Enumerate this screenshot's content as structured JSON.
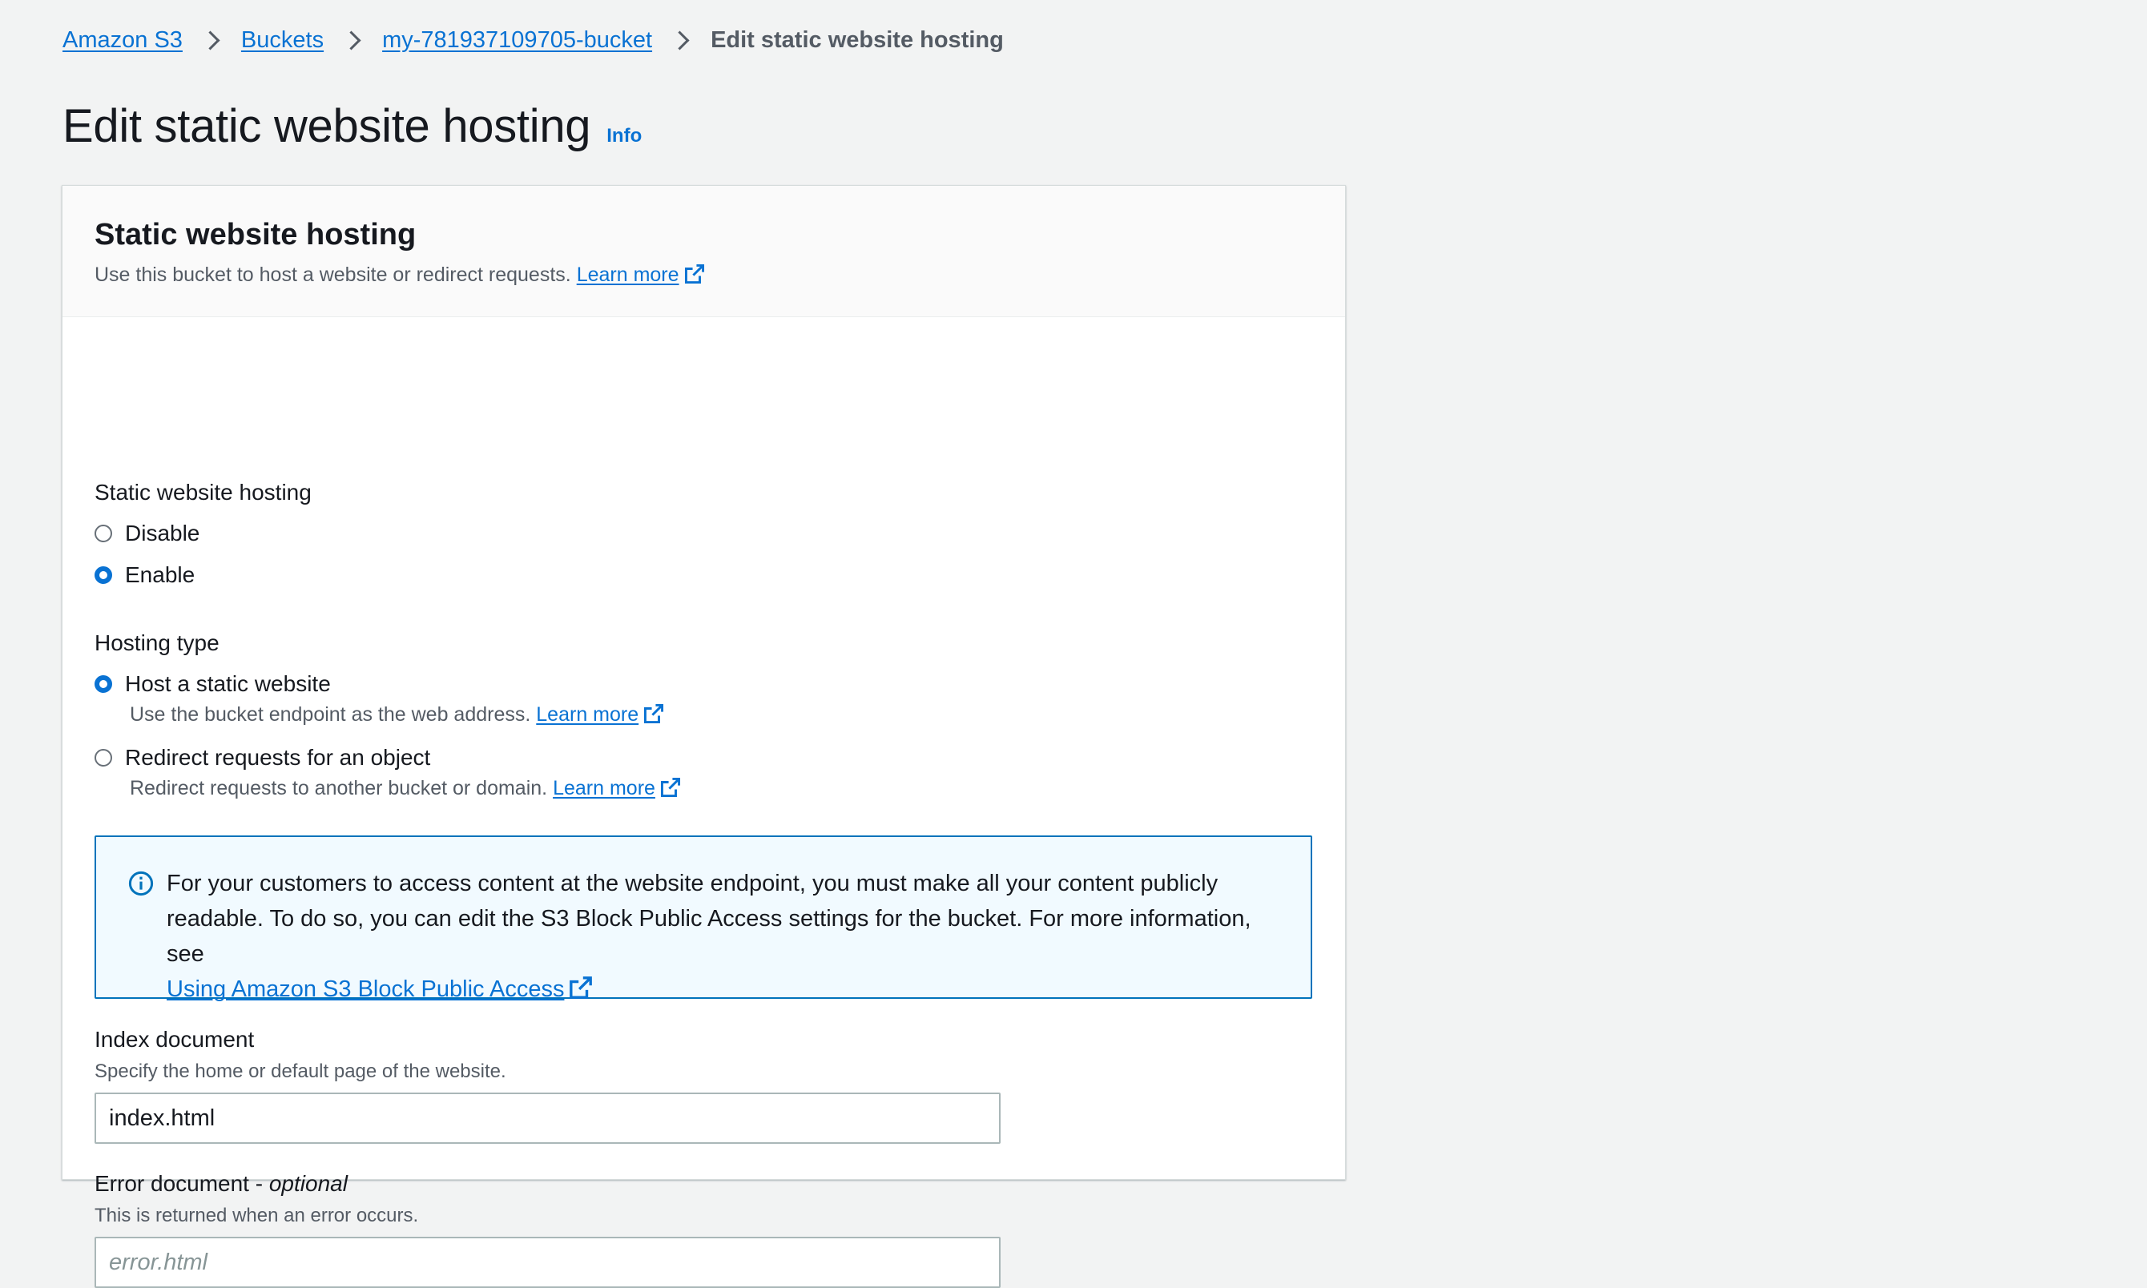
{
  "breadcrumb": {
    "items": [
      "Amazon S3",
      "Buckets",
      "my-781937109705-bucket"
    ],
    "current": "Edit static website hosting"
  },
  "page": {
    "title": "Edit static website hosting",
    "info": "Info"
  },
  "section": {
    "title": "Static website hosting",
    "description": "Use this bucket to host a website or redirect requests.",
    "learn_more": "Learn more"
  },
  "hosting": {
    "label": "Static website hosting",
    "options": [
      "Disable",
      "Enable"
    ],
    "selected": "Enable"
  },
  "hosting_type": {
    "label": "Hosting type",
    "options": [
      {
        "label": "Host a static website",
        "description": "Use the bucket endpoint as the web address.",
        "learn_more": "Learn more"
      },
      {
        "label": "Redirect requests for an object",
        "description": "Redirect requests to another bucket or domain.",
        "learn_more": "Learn more"
      }
    ],
    "selected": "Host a static website"
  },
  "alert": {
    "text": "For your customers to access content at the website endpoint, you must make all your content publicly readable. To do so, you can edit the S3 Block Public Access settings for the bucket. For more information, see",
    "link": "Using Amazon S3 Block Public Access"
  },
  "index_document": {
    "label": "Index document",
    "description": "Specify the home or default page of the website.",
    "value": "index.html"
  },
  "error_document": {
    "label": "Error document - ",
    "label_suffix": "optional",
    "description": "This is returned when an error occurs.",
    "placeholder": "error.html",
    "value": ""
  },
  "colors": {
    "link": "#0972d3",
    "background": "#f2f3f3",
    "alert_border": "#0073bb",
    "alert_background": "#f1faff"
  }
}
